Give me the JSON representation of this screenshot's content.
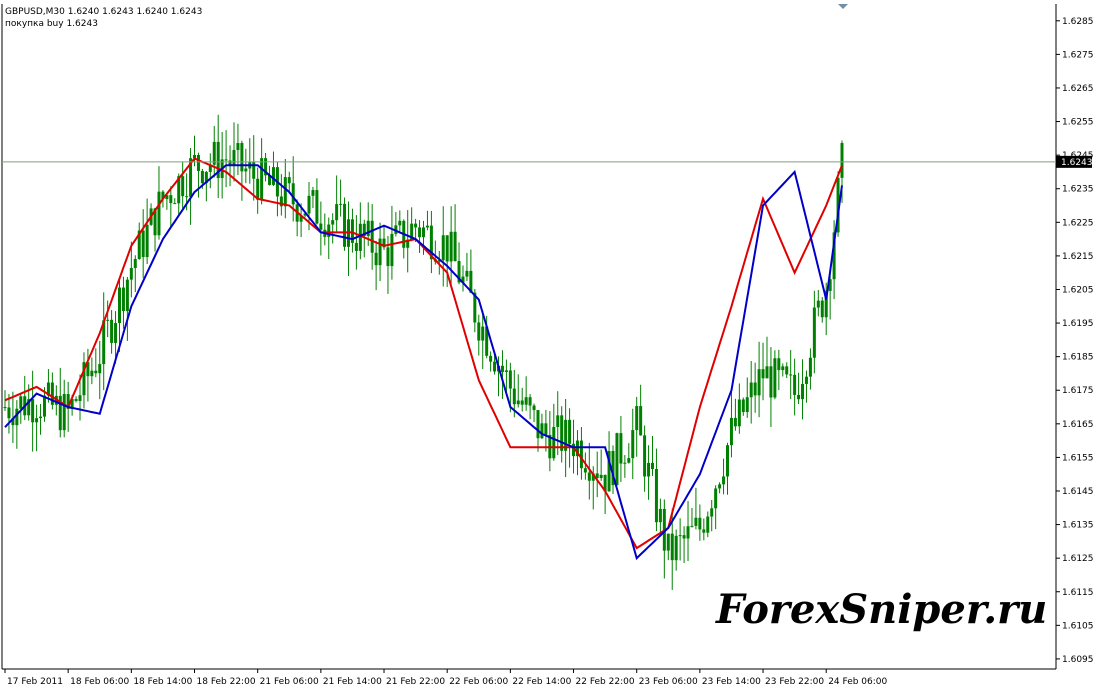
{
  "header": {
    "symbol_line": "GBPUSD,M30  1.6240 1.6243 1.6240 1.6243",
    "order_line": "покупка buy 1.6243"
  },
  "watermark": "ForexSniper.ru",
  "colors": {
    "background": "#ffffff",
    "axis": "#000000",
    "candle": "#008000",
    "fast_line": "#e00000",
    "slow_line": "#0000c8",
    "current_price_line": "#7f9f7f",
    "current_price_label_bg": "#000000",
    "current_price_label_fg": "#ffffff"
  },
  "chart_data": {
    "type": "line",
    "symbol": "GBPUSD",
    "timeframe": "M30",
    "ylim": [
      1.6092,
      1.629
    ],
    "yticks": [
      "1.6285",
      "1.6275",
      "1.6265",
      "1.6255",
      "1.6245",
      "1.6235",
      "1.6225",
      "1.6215",
      "1.6205",
      "1.6195",
      "1.6185",
      "1.6175",
      "1.6165",
      "1.6155",
      "1.6145",
      "1.6135",
      "1.6125",
      "1.6115",
      "1.6105",
      "1.6095"
    ],
    "current_price": "1.6243",
    "xticks": [
      "17 Feb 2011",
      "18 Feb 06:00",
      "18 Feb 14:00",
      "18 Feb 22:00",
      "21 Feb 06:00",
      "21 Feb 14:00",
      "21 Feb 22:00",
      "22 Feb 06:00",
      "22 Feb 14:00",
      "22 Feb 22:00",
      "23 Feb 06:00",
      "23 Feb 14:00",
      "23 Feb 22:00",
      "24 Feb 06:00"
    ],
    "x": [
      0,
      8,
      16,
      24,
      32,
      40,
      48,
      56,
      64,
      72,
      80,
      88,
      96,
      104,
      112,
      120,
      128,
      136,
      144,
      152,
      160,
      168,
      176,
      184,
      192,
      200,
      208,
      212
    ],
    "close": [
      1.617,
      1.6172,
      1.6168,
      1.6186,
      1.6212,
      1.6232,
      1.6242,
      1.6244,
      1.6238,
      1.6232,
      1.6228,
      1.6222,
      1.6216,
      1.6224,
      1.6218,
      1.6196,
      1.6176,
      1.6162,
      1.616,
      1.615,
      1.6164,
      1.6126,
      1.6134,
      1.6162,
      1.618,
      1.6174,
      1.6206,
      1.6242
    ],
    "series": [
      {
        "name": "",
        "values": [
          1.6172,
          1.6176,
          1.617,
          1.6192,
          1.6218,
          1.6232,
          1.6244,
          1.624,
          1.6232,
          1.623,
          1.6222,
          1.6222,
          1.6218,
          1.622,
          1.621,
          1.6178,
          1.6158,
          1.6158,
          1.6158,
          1.6145,
          1.6128,
          1.6134,
          1.617,
          1.62,
          1.6232,
          1.621,
          1.623,
          1.6242
        ]
      },
      {
        "name": "",
        "values": [
          1.6164,
          1.6174,
          1.617,
          1.6168,
          1.62,
          1.622,
          1.6234,
          1.6242,
          1.6242,
          1.6234,
          1.6222,
          1.622,
          1.6224,
          1.622,
          1.6212,
          1.6202,
          1.617,
          1.6162,
          1.6158,
          1.6158,
          1.6125,
          1.6134,
          1.615,
          1.6175,
          1.623,
          1.624,
          1.6202,
          1.6236
        ]
      }
    ]
  }
}
